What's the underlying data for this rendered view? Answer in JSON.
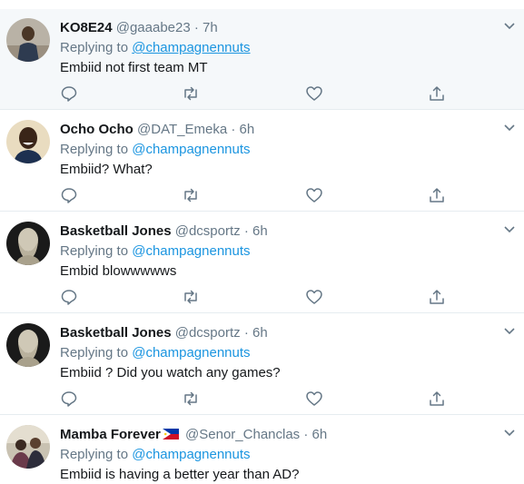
{
  "tweets": [
    {
      "name": "KO8E24",
      "handle": "@gaaabe23",
      "time": "7h",
      "replying_prefix": "Replying to",
      "replying_to": "@champagnennuts",
      "text": "Embiid not first team MT",
      "avatar_icon": "person-photo"
    },
    {
      "name": "Ocho Ocho",
      "handle": "@DAT_Emeka",
      "time": "6h",
      "replying_prefix": "Replying to",
      "replying_to": "@champagnennuts",
      "text": "Embiid? What?",
      "avatar_icon": "smiling-man-photo"
    },
    {
      "name": "Basketball Jones",
      "handle": "@dcsportz",
      "time": "6h",
      "replying_prefix": "Replying to",
      "replying_to": "@champagnennuts",
      "text": "Embid blowwwwws",
      "avatar_icon": "bust-statue"
    },
    {
      "name": "Basketball Jones",
      "handle": "@dcsportz",
      "time": "6h",
      "replying_prefix": "Replying to",
      "replying_to": "@champagnennuts",
      "text": "Embiid ? Did you watch any games?",
      "avatar_icon": "bust-statue"
    },
    {
      "name": "Mamba Forever",
      "handle": "@Senor_Chanclas",
      "time": "6h",
      "replying_prefix": "Replying to",
      "replying_to": "@champagnennuts",
      "text": "Embiid is having a better year than AD?",
      "avatar_icon": "group-photo",
      "flag_icon": "philippines-flag"
    }
  ],
  "separator": "·",
  "colors": {
    "link": "#1b95e0",
    "muted": "#657786",
    "text": "#14171a",
    "border": "#e6ecf0",
    "highlight_bg": "#f5f8fa"
  }
}
